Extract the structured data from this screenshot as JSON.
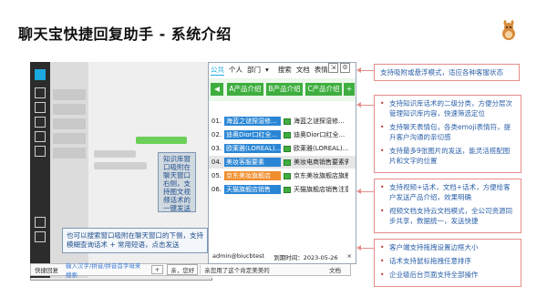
{
  "title": "聊天宝快捷回复助手 - 系统介绍",
  "logo_icon": "cartoon-mascot-icon",
  "chat_overlay_note": "知识库窗口吸附在聊天窗口右侧，支持图文视频话术的一键发送",
  "left_note": "也可以搜索窗口吸附在聊天窗口的下侧，支持模糊查询话术 + 常用短语，点击发送",
  "bottom_bar": {
    "label": "快捷回复",
    "input_placeholder": "输入汉字/拼音/拼音首字母来搜索",
    "add_button": "+",
    "quick_phrase": "亲，您好",
    "phrase_text": "亲您用了这个肯定美美的",
    "doc_label": "文档"
  },
  "panel": {
    "tabs": [
      "公共",
      "个人",
      "部门",
      "搜索",
      "文档",
      "表情"
    ],
    "active_tab": "公共",
    "dept_caret": "▾",
    "icons": [
      "pin-icon",
      "settings-icon"
    ],
    "category_buttons": [
      "A产品介绍",
      "B产品介绍",
      "C产品介绍"
    ],
    "back_button": "back-arrow-icon",
    "add_button": "+",
    "rows": [
      {
        "num": "01.",
        "tag": "海蓝之谜探湿修...",
        "text": "海蓝之谜探湿修...",
        "tag_color": "#2a86d5"
      },
      {
        "num": "02.",
        "tag": "迪奥Dior口红全...",
        "text": "迪奥Dior口红全...",
        "tag_color": "#2a86d5"
      },
      {
        "num": "03.",
        "tag": "欧莱雅(LOREAL)...",
        "text": "欧莱雅(LOREAL)...",
        "tag_color": "#2a86d5"
      },
      {
        "num": "04.",
        "tag": "美妆客服要素",
        "text": "美妆电商销售要素需要注...",
        "tag_color": "#2a86d5",
        "selected": true
      },
      {
        "num": "05.",
        "tag": "京东美妆旗舰店",
        "text": "京东美妆旗舰店旗舰...",
        "tag_color": "#f08d2c"
      },
      {
        "num": "06.",
        "tag": "天猫旗舰店销售",
        "text": "天猫旗舰店销售注意...",
        "tag_color": "#2a86d5"
      }
    ],
    "status_user": "admin@biucbtest",
    "status_expiry": "到期时间：2023-05-26",
    "close_icon": "×"
  },
  "callouts": {
    "top": "支持吸附或悬浮模式，适应各种客服状态",
    "middle": [
      "支持知识库话术的二级分类，方便分层次管理知识库内容，快速筛选定位",
      "支持聊天表情包，各类emoji表情符，提升客户沟通的亲切感",
      "支持最多9张图片的发送，能灵活搭配图片和文字的位置"
    ],
    "lower": [
      "支持视频+话术，文档+话术，方便给客户发送产品介绍，效果明确",
      "视频文档支持云文档模式，全公司资源同步共享，数据统一，发送快捷"
    ],
    "bottom": [
      "客户端支持拖拽设置边框大小",
      "话术支持鼠标拖拽任意排序",
      "企业级后台页面支持全部操作"
    ]
  }
}
